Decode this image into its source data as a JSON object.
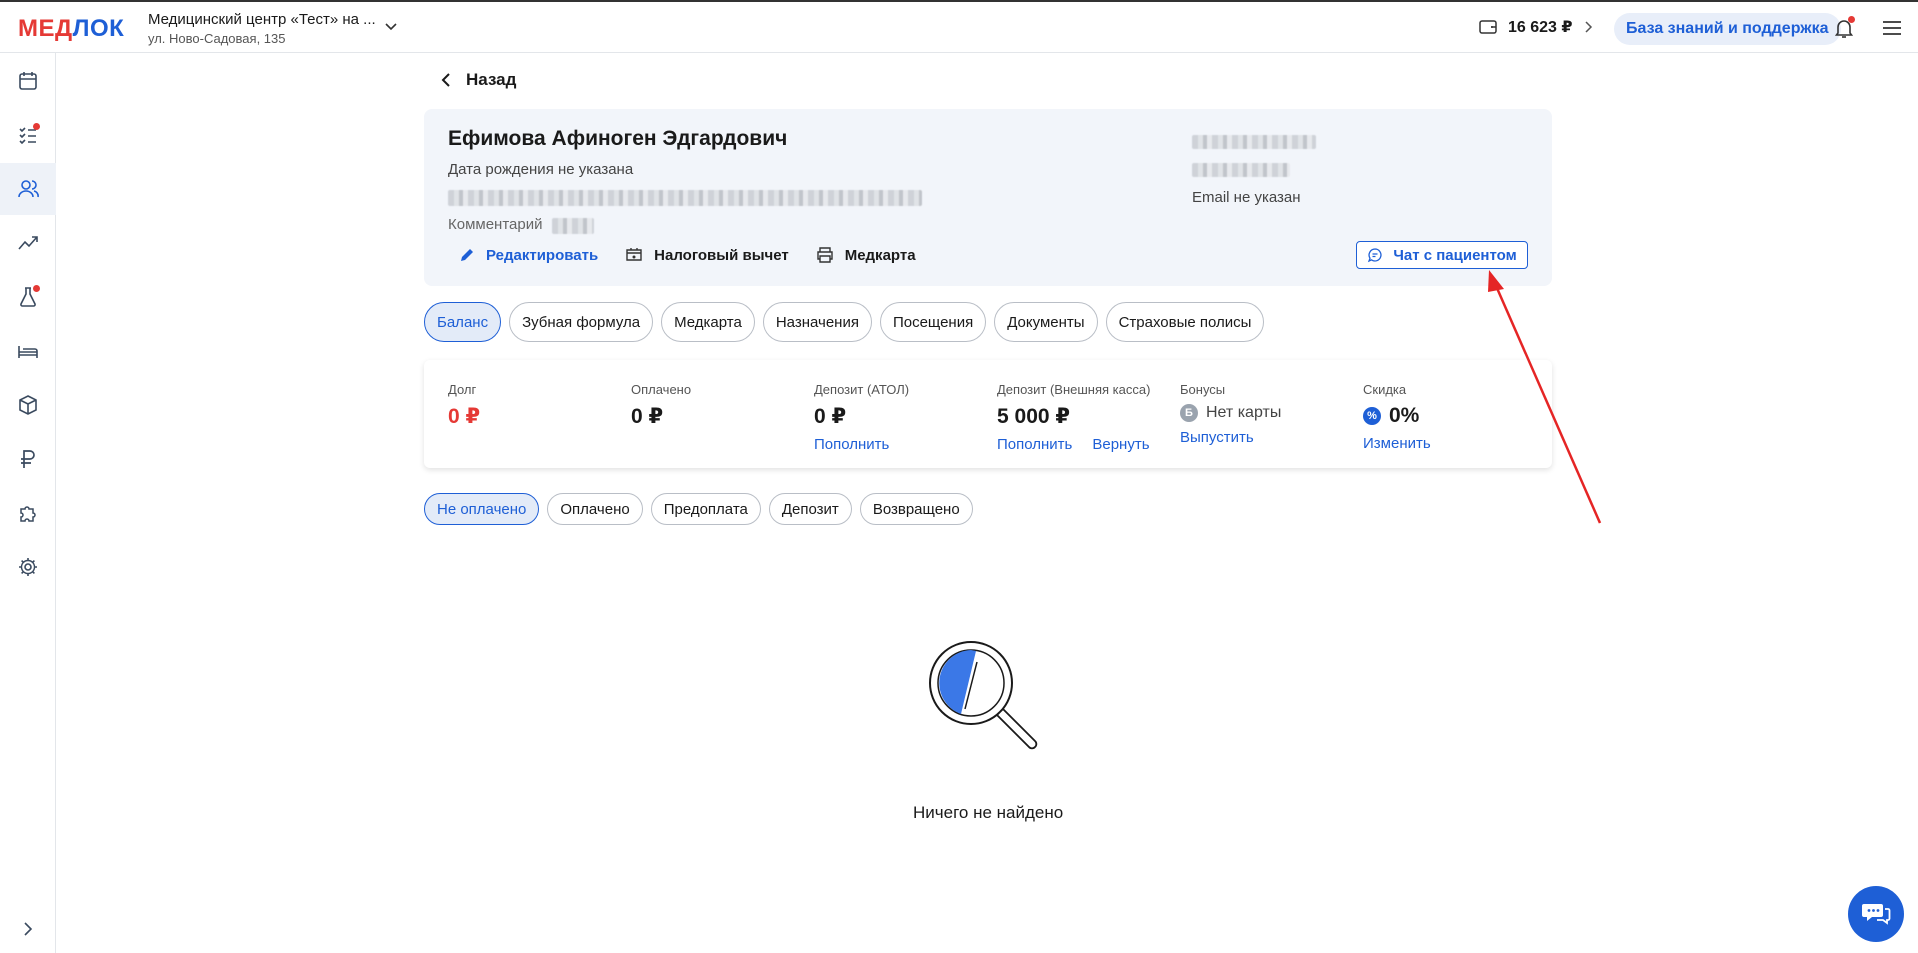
{
  "header": {
    "logo_part1": "МЕД",
    "logo_part2": "ЛОК",
    "clinic_name": "Медицинский центр «Тест» на ...",
    "clinic_address": "ул. Ново-Садовая, 135",
    "balance": "16 623 ₽",
    "knowledge_base_label": "База знаний и поддержка"
  },
  "sidebar": {
    "items": [
      {
        "icon": "calendar-icon"
      },
      {
        "icon": "task-list-icon",
        "badge": true
      },
      {
        "icon": "users-icon",
        "active": true
      },
      {
        "icon": "chart-icon"
      },
      {
        "icon": "flask-icon",
        "badge": true
      },
      {
        "icon": "bed-icon"
      },
      {
        "icon": "box-icon"
      },
      {
        "icon": "ruble-icon"
      },
      {
        "icon": "puzzle-icon"
      },
      {
        "icon": "gear-icon"
      }
    ]
  },
  "back_label": "Назад",
  "patient": {
    "name": "Ефимова Афиноген Эдгардович",
    "birth_date": "Дата рождения не указана",
    "comment_label": "Комментарий",
    "email": "Email не указан",
    "actions": {
      "edit": "Редактировать",
      "tax": "Налоговый вычет",
      "medcard": "Медкарта"
    },
    "chat_label": "Чат с пациентом"
  },
  "tabs": [
    "Баланс",
    "Зубная формула",
    "Медкарта",
    "Назначения",
    "Посещения",
    "Документы",
    "Страховые полисы"
  ],
  "active_tab": "Баланс",
  "balance": {
    "debt": {
      "label": "Долг",
      "value": "0 ₽"
    },
    "paid": {
      "label": "Оплачено",
      "value": "0 ₽"
    },
    "deposit_atol": {
      "label": "Депозит (АТОЛ)",
      "value": "0 ₽",
      "link": "Пополнить"
    },
    "deposit_external": {
      "label": "Депозит (Внешняя касса)",
      "value": "5 000 ₽",
      "link1": "Пополнить",
      "link2": "Вернуть"
    },
    "bonuses": {
      "label": "Бонусы",
      "coin": "Б",
      "value": "Нет карты",
      "link": "Выпустить"
    },
    "discount": {
      "label": "Скидка",
      "badge": "%",
      "value": "0%",
      "link": "Изменить"
    }
  },
  "filters": [
    "Не оплачено",
    "Оплачено",
    "Предоплата",
    "Депозит",
    "Возвращено"
  ],
  "active_filter": "Не оплачено",
  "empty_state": "Ничего не найдено",
  "colors": {
    "accent": "#1e5fd6",
    "danger": "#e53935",
    "card_bg": "#f2f5fa"
  }
}
